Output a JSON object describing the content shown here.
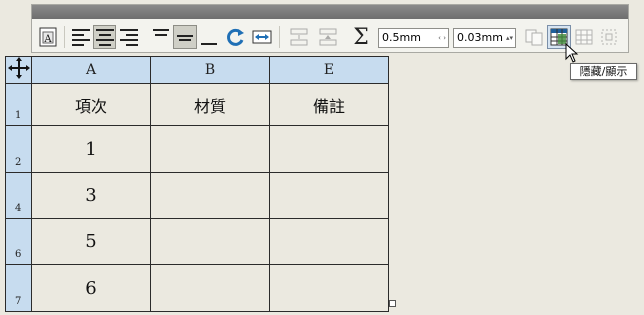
{
  "toolbar": {
    "width_value": "0.5mm",
    "width_arrows": "‹ ›",
    "stroke_value": "0.03mm",
    "stroke_arrows": "▴▾",
    "sigma": "Σ",
    "buttons": [
      {
        "name": "text-frame-icon"
      },
      {
        "name": "align-left-icon"
      },
      {
        "name": "align-center-icon"
      },
      {
        "name": "align-right-icon"
      },
      {
        "name": "valign-top-icon"
      },
      {
        "name": "valign-middle-icon"
      },
      {
        "name": "valign-bottom-icon"
      },
      {
        "name": "rotate-icon"
      },
      {
        "name": "fit-width-icon"
      },
      {
        "name": "insert-row-below-icon"
      },
      {
        "name": "insert-row-above-icon"
      },
      {
        "name": "sum-icon"
      },
      {
        "name": "copy-table-icon"
      },
      {
        "name": "show-hide-table-icon"
      },
      {
        "name": "grid-icon"
      },
      {
        "name": "select-frame-icon"
      }
    ]
  },
  "tooltip": "隱藏/顯示",
  "table": {
    "corner_icon": "move-handle-icon",
    "columns": [
      "A",
      "B",
      "E"
    ],
    "rows": [
      {
        "num": "1",
        "cells": [
          "項次",
          "材質",
          "備註"
        ]
      },
      {
        "num": "2",
        "cells": [
          "1",
          "",
          ""
        ]
      },
      {
        "num": "4",
        "cells": [
          "3",
          "",
          ""
        ]
      },
      {
        "num": "6",
        "cells": [
          "5",
          "",
          ""
        ]
      },
      {
        "num": "7",
        "cells": [
          "6",
          "",
          ""
        ]
      }
    ]
  }
}
